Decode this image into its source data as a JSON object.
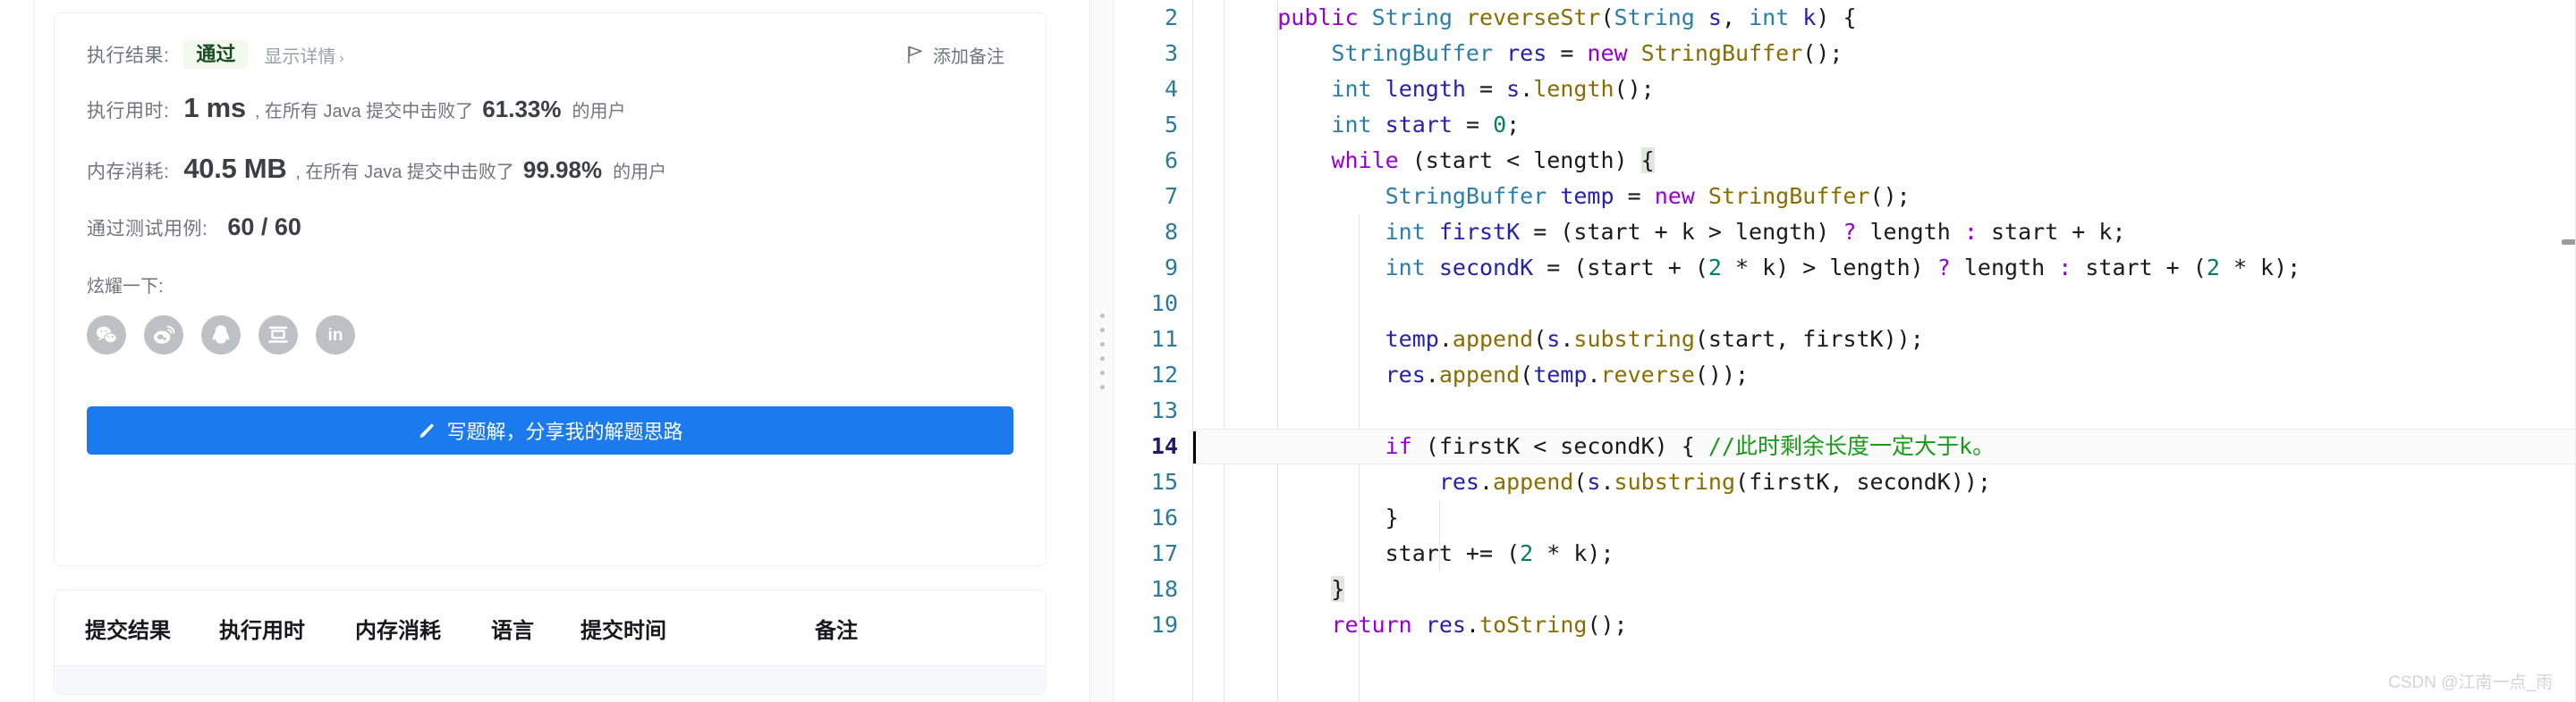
{
  "submission": {
    "result_label": "执行结果:",
    "result_status": "通过",
    "detail_link": "显示详情",
    "detail_chevron": "›",
    "add_note_label": "添加备注",
    "add_note_icon": "flag-icon",
    "runtime_label": "执行用时:",
    "runtime_value": "1 ms",
    "runtime_mid": ", 在所有 Java 提交中击败了",
    "runtime_percent": "61.33%",
    "runtime_suffix": "的用户",
    "memory_label": "内存消耗:",
    "memory_value": "40.5 MB",
    "memory_mid": ", 在所有 Java 提交中击败了",
    "memory_percent": "99.98%",
    "memory_suffix": "的用户",
    "testcases_label": "通过测试用例:",
    "testcases_value": "60 / 60",
    "flaunt_label": "炫耀一下:",
    "share_targets": [
      {
        "name": "wechat-icon",
        "glyph": ""
      },
      {
        "name": "weibo-icon",
        "glyph": ""
      },
      {
        "name": "qq-icon",
        "glyph": ""
      },
      {
        "name": "douban-icon",
        "glyph": "豆"
      },
      {
        "name": "linkedin-icon",
        "glyph": "in"
      }
    ],
    "write_solution_button": "写题解，分享我的解题思路",
    "write_solution_icon": "pencil-icon",
    "accent_blue": "#1a7aee",
    "accept_green": "#1b4d24",
    "accept_bg": "#f2f9ef"
  },
  "history_table": {
    "columns": [
      "提交结果",
      "执行用时",
      "内存消耗",
      "语言",
      "提交时间",
      "备注"
    ]
  },
  "editor": {
    "current_line": 14,
    "line_number_color": "#2b7a99",
    "current_line_number_color": "#1a1a6e",
    "lines": [
      {
        "n": 2,
        "tokens": [
          [
            "op",
            "    "
          ],
          [
            "kw",
            "public"
          ],
          [
            "op",
            " "
          ],
          [
            "type",
            "String"
          ],
          [
            "op",
            " "
          ],
          [
            "fn",
            "reverseStr"
          ],
          [
            "op",
            "("
          ],
          [
            "type",
            "String"
          ],
          [
            "op",
            " "
          ],
          [
            "var",
            "s"
          ],
          [
            "op",
            ", "
          ],
          [
            "type",
            "int"
          ],
          [
            "op",
            " "
          ],
          [
            "var",
            "k"
          ],
          [
            "op",
            ") {"
          ]
        ]
      },
      {
        "n": 3,
        "tokens": [
          [
            "op",
            "        "
          ],
          [
            "type",
            "StringBuffer"
          ],
          [
            "op",
            " "
          ],
          [
            "var",
            "res"
          ],
          [
            "op",
            " = "
          ],
          [
            "kw",
            "new"
          ],
          [
            "op",
            " "
          ],
          [
            "fn",
            "StringBuffer"
          ],
          [
            "op",
            "();"
          ]
        ]
      },
      {
        "n": 4,
        "tokens": [
          [
            "op",
            "        "
          ],
          [
            "type",
            "int"
          ],
          [
            "op",
            " "
          ],
          [
            "var",
            "length"
          ],
          [
            "op",
            " = "
          ],
          [
            "var",
            "s"
          ],
          [
            "op",
            "."
          ],
          [
            "fn",
            "length"
          ],
          [
            "op",
            "();"
          ]
        ]
      },
      {
        "n": 5,
        "tokens": [
          [
            "op",
            "        "
          ],
          [
            "type",
            "int"
          ],
          [
            "op",
            " "
          ],
          [
            "var",
            "start"
          ],
          [
            "op",
            " = "
          ],
          [
            "num",
            "0"
          ],
          [
            "op",
            ";"
          ]
        ]
      },
      {
        "n": 6,
        "tokens": [
          [
            "op",
            "        "
          ],
          [
            "kw",
            "while"
          ],
          [
            "op",
            " (start < length) "
          ],
          [
            "brace",
            "{"
          ]
        ]
      },
      {
        "n": 7,
        "tokens": [
          [
            "op",
            "            "
          ],
          [
            "type",
            "StringBuffer"
          ],
          [
            "op",
            " "
          ],
          [
            "var",
            "temp"
          ],
          [
            "op",
            " = "
          ],
          [
            "kw",
            "new"
          ],
          [
            "op",
            " "
          ],
          [
            "fn",
            "StringBuffer"
          ],
          [
            "op",
            "();"
          ]
        ]
      },
      {
        "n": 8,
        "tokens": [
          [
            "op",
            "            "
          ],
          [
            "type",
            "int"
          ],
          [
            "op",
            " "
          ],
          [
            "var",
            "firstK"
          ],
          [
            "op",
            " = (start + k > length) "
          ],
          [
            "kw",
            "?"
          ],
          [
            "op",
            " length "
          ],
          [
            "kw",
            ":"
          ],
          [
            "op",
            " start + k;"
          ]
        ]
      },
      {
        "n": 9,
        "tokens": [
          [
            "op",
            "            "
          ],
          [
            "type",
            "int"
          ],
          [
            "op",
            " "
          ],
          [
            "var",
            "secondK"
          ],
          [
            "op",
            " = (start + ("
          ],
          [
            "num",
            "2"
          ],
          [
            "op",
            " * k) > length) "
          ],
          [
            "kw",
            "?"
          ],
          [
            "op",
            " length "
          ],
          [
            "kw",
            ":"
          ],
          [
            "op",
            " start + ("
          ],
          [
            "num",
            "2"
          ],
          [
            "op",
            " * k);"
          ]
        ]
      },
      {
        "n": 10,
        "tokens": []
      },
      {
        "n": 11,
        "tokens": [
          [
            "op",
            "            "
          ],
          [
            "var",
            "temp"
          ],
          [
            "op",
            "."
          ],
          [
            "fn",
            "append"
          ],
          [
            "op",
            "("
          ],
          [
            "var",
            "s"
          ],
          [
            "op",
            "."
          ],
          [
            "fn",
            "substring"
          ],
          [
            "op",
            "(start, firstK));"
          ]
        ]
      },
      {
        "n": 12,
        "tokens": [
          [
            "op",
            "            "
          ],
          [
            "var",
            "res"
          ],
          [
            "op",
            "."
          ],
          [
            "fn",
            "append"
          ],
          [
            "op",
            "("
          ],
          [
            "var",
            "temp"
          ],
          [
            "op",
            "."
          ],
          [
            "fn",
            "reverse"
          ],
          [
            "op",
            "());"
          ]
        ]
      },
      {
        "n": 13,
        "tokens": []
      },
      {
        "n": 14,
        "tokens": [
          [
            "op",
            "            "
          ],
          [
            "kw",
            "if"
          ],
          [
            "op",
            " (firstK < secondK) { "
          ],
          [
            "cmt",
            "//此时剩余长度一定大于k。"
          ]
        ]
      },
      {
        "n": 15,
        "tokens": [
          [
            "op",
            "                "
          ],
          [
            "var",
            "res"
          ],
          [
            "op",
            "."
          ],
          [
            "fn",
            "append"
          ],
          [
            "op",
            "("
          ],
          [
            "var",
            "s"
          ],
          [
            "op",
            "."
          ],
          [
            "fn",
            "substring"
          ],
          [
            "op",
            "(firstK, secondK));"
          ]
        ]
      },
      {
        "n": 16,
        "tokens": [
          [
            "op",
            "            }"
          ]
        ]
      },
      {
        "n": 17,
        "tokens": [
          [
            "op",
            "            start += ("
          ],
          [
            "num",
            "2"
          ],
          [
            "op",
            " * k);"
          ]
        ]
      },
      {
        "n": 18,
        "tokens": [
          [
            "op",
            "        "
          ],
          [
            "brace",
            "}"
          ]
        ]
      },
      {
        "n": 19,
        "tokens": [
          [
            "op",
            "        "
          ],
          [
            "kw",
            "return"
          ],
          [
            "op",
            " "
          ],
          [
            "var",
            "res"
          ],
          [
            "op",
            "."
          ],
          [
            "fn",
            "toString"
          ],
          [
            "op",
            "();"
          ]
        ]
      }
    ]
  },
  "watermark": "CSDN @江南一点_雨"
}
